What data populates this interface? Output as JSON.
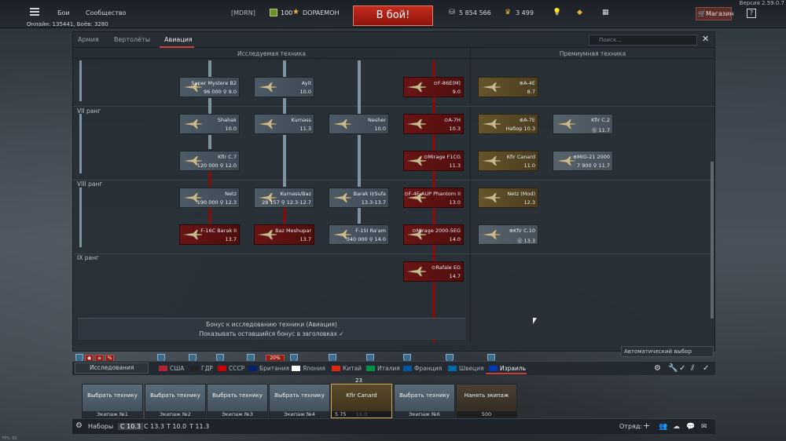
{
  "version": "Версия 2.59.0.7",
  "topbar": {
    "nav": [
      "Бои",
      "Сообщество"
    ],
    "online": "Онлайн: 135441, Боёв: 3280",
    "clan": "[MDRN]",
    "level": "100",
    "nickname": "DOPAEMOH",
    "battle_button": "В бой!",
    "silver": "5 854 566",
    "gold": "3 499",
    "shop": "Магазин",
    "help": "?"
  },
  "panel": {
    "tabs": [
      "Армия",
      "Вертолёты",
      "Авиация"
    ],
    "active_tab": "Авиация",
    "search_placeholder": "Поиск...",
    "col_research": "Исследуемая техника",
    "col_premium": "Премиумная техника",
    "ranks": [
      "VII ранг",
      "VIII ранг",
      "IX ранг"
    ],
    "bonus_title": "Бонус к исследованию техники (Авиация)",
    "bonus_toggle": "Показывать оставшийся бонус в заголовках",
    "auto_select": "Автоматический выбор"
  },
  "vehicles": [
    {
      "id": "super-mystere",
      "name": "Super Mystere B2",
      "br": "96 000 ⚲ 9.0",
      "style": "gray"
    },
    {
      "id": "ayit",
      "name": "Ayit",
      "br": "10.0",
      "style": "gray"
    },
    {
      "id": "f86",
      "name": "⊙F-86E(M)",
      "br": "9.0",
      "style": "red"
    },
    {
      "id": "a4e",
      "name": "⊕A-4E",
      "br": "8.7",
      "style": "gold"
    },
    {
      "id": "shahak",
      "name": "Shahak",
      "br": "10.0",
      "style": "gray"
    },
    {
      "id": "kurnass",
      "name": "Kurnass",
      "br": "11.3",
      "style": "gray"
    },
    {
      "id": "nesher",
      "name": "Nesher",
      "br": "10.0",
      "style": "gray"
    },
    {
      "id": "a7h",
      "name": "⊙A-7H",
      "br": "10.3",
      "style": "red"
    },
    {
      "id": "a7e",
      "name": "⊕A-7E",
      "br": "Набор 10.3",
      "style": "gold"
    },
    {
      "id": "kfirc2",
      "name": "Kfir C.2",
      "br": "Ⓖ 11.7",
      "style": "ltgray"
    },
    {
      "id": "kfirc7",
      "name": "Kfir C.7",
      "br": "120 000 ⚲ 12.0",
      "style": "gray"
    },
    {
      "id": "miragef1",
      "name": "⊙Mirage F1CG",
      "br": "11.3",
      "style": "red"
    },
    {
      "id": "kfircanard",
      "name": "Kfir Canard",
      "br": "11.0",
      "style": "gold"
    },
    {
      "id": "mig21",
      "name": "⊕MiG-21 2000",
      "br": "7 900 ⚲ 11.7",
      "style": "ltgray"
    },
    {
      "id": "netz",
      "name": "Netz",
      "br": "190 000 ⚲ 12.3",
      "style": "gray"
    },
    {
      "id": "kurnassbaz",
      "name": "Kurnass/Baz",
      "br": "28 157 ⚲ 12.3-12.7",
      "style": "gray"
    },
    {
      "id": "barak",
      "name": "Barak II/Sufa",
      "br": "13.3-13.7",
      "style": "gray"
    },
    {
      "id": "f4e",
      "name": "⊙F-4E AUP Phantom II",
      "br": "13.0",
      "style": "red"
    },
    {
      "id": "netzmod",
      "name": "Netz (Mod)",
      "br": "12.3",
      "style": "gold"
    },
    {
      "id": "f16c",
      "name": "F-16C Barak II",
      "br": "13.7",
      "style": "red"
    },
    {
      "id": "baz",
      "name": "Baz Meshupar",
      "br": "13.7",
      "style": "red"
    },
    {
      "id": "f15i",
      "name": "F-15I Ra'am",
      "br": "340 000 ⚲ 14.0",
      "style": "gray"
    },
    {
      "id": "mirage2000",
      "name": "⊙Mirage 2000-5EG",
      "br": "14.0",
      "style": "red"
    },
    {
      "id": "kfirc10",
      "name": "⊕Kfir C.10",
      "br": "Ⓖ 13.3",
      "style": "ltgray"
    },
    {
      "id": "rafale",
      "name": "⊙Rafale EG",
      "br": "14.7",
      "style": "red"
    }
  ],
  "countries": {
    "research_button": "Исследования",
    "list": [
      "США",
      "ГДР",
      "СССР",
      "Британия",
      "Япония",
      "Китай",
      "Италия",
      "Франция",
      "Швеция",
      "Израиль"
    ],
    "badges": [
      "20%"
    ]
  },
  "crews": [
    {
      "label": "Выбрать технику",
      "footer": "Экипаж №1"
    },
    {
      "label": "Выбрать технику",
      "footer": "Экипаж №2"
    },
    {
      "label": "Выбрать технику",
      "footer": "Экипаж №3"
    },
    {
      "label": "Выбрать технику",
      "footer": "Экипаж №4"
    },
    {
      "label": "Kfir Canard",
      "footer": "11.0",
      "extra": "5   75"
    },
    {
      "label": "Выбрать технику",
      "footer": "Экипаж №6"
    },
    {
      "label": "Нанять экипаж",
      "footer": "500"
    }
  ],
  "crew_count": "23",
  "bottom": {
    "presets": "Наборы",
    "br_tabs": [
      "С 10.3",
      "С 13.3",
      "Т 10.0",
      "Т 11.3"
    ],
    "squad": "Отряд:"
  },
  "fps": "FPS: 60",
  "colors": {
    "accent": "#c8412e",
    "battle": "#b3231a",
    "premium": "#66552a",
    "event": "#6a1414"
  }
}
